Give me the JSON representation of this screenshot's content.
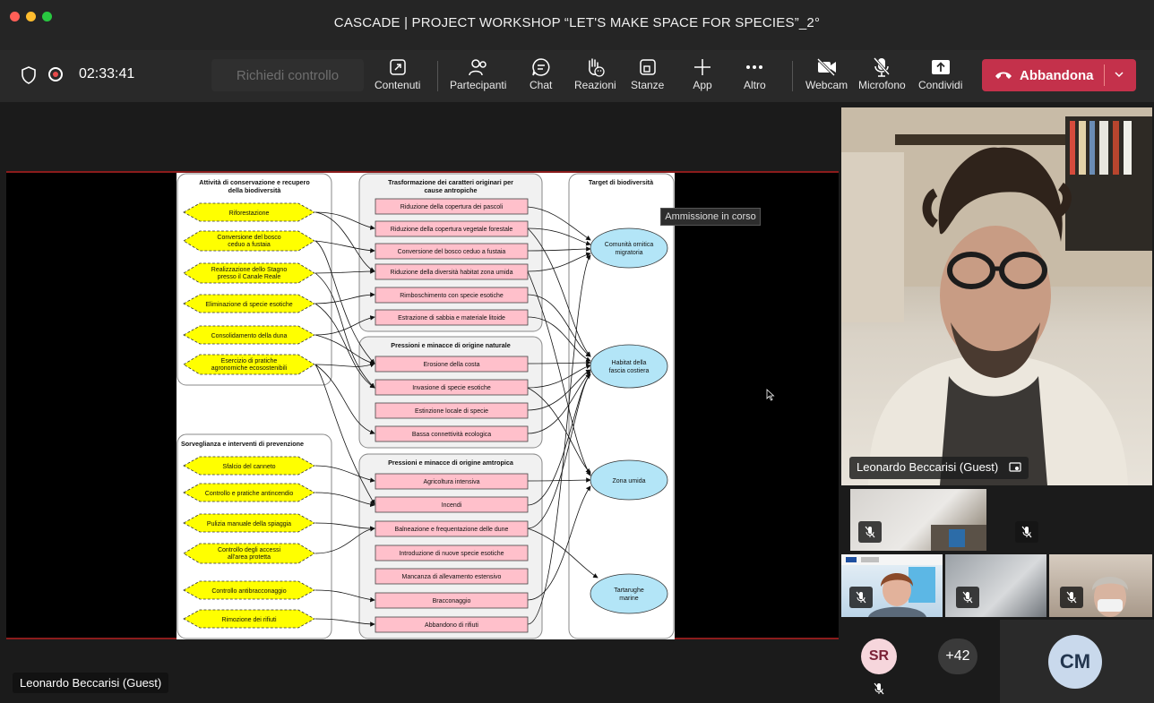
{
  "window": {
    "title": "CASCADE | PROJECT WORKSHOP “LET'S MAKE SPACE FOR SPECIES”_2°",
    "traffic_colors": [
      "#ff5f57",
      "#febc2e",
      "#28c840"
    ]
  },
  "toolbar": {
    "timer": "02:33:41",
    "request_control": "Richiedi controllo",
    "buttons": [
      {
        "id": "contenuti",
        "label": "Contenuti",
        "icon": "share-content-icon"
      },
      {
        "id": "partecipanti",
        "label": "Partecipanti",
        "icon": "people-icon"
      },
      {
        "id": "chat",
        "label": "Chat",
        "icon": "chat-icon"
      },
      {
        "id": "reazioni",
        "label": "Reazioni",
        "icon": "raise-hand-icon"
      },
      {
        "id": "stanze",
        "label": "Stanze",
        "icon": "rooms-icon"
      },
      {
        "id": "app",
        "label": "App",
        "icon": "plus-icon"
      },
      {
        "id": "altro",
        "label": "Altro",
        "icon": "more-icon"
      },
      {
        "id": "webcam",
        "label": "Webcam",
        "icon": "camera-off-icon"
      },
      {
        "id": "microfono",
        "label": "Microfono",
        "icon": "mic-off-icon"
      },
      {
        "id": "condividi",
        "label": "Condividi",
        "icon": "share-screen-icon"
      }
    ],
    "leave_label": "Abbandona",
    "leave_color": "#c4314b"
  },
  "stage": {
    "tooltip": "Ammissione in corso",
    "presenter_label": "Leonardo Beccarisi (Guest)"
  },
  "slide": {
    "col1_header": "Attività di conservazione e recupero della biodiversità",
    "col1_items": [
      "Riforestazione",
      "Conversione del bosco ceduo a fustaia",
      "Realizzazione dello Stagno presso il Canale Reale",
      "Eliminazione di specie esotiche",
      "Consolidamento della duna",
      "Esercizio di pratiche agronomiche ecosostenibili"
    ],
    "col1b_header": "Sorveglianza e interventi di prevenzione",
    "col1b_items": [
      "Sfalcio del canneto",
      "Controllo e pratiche antincendio",
      "Pulizia manuale della spiaggia",
      "Controllo degli accessi all'area protetta",
      "Controllo antibracconaggio",
      "Rimozione dei rifiuti"
    ],
    "col2_header": "Trasformazione dei caratteri originari per cause antropiche",
    "col2_items": [
      "Riduzione della copertura dei pascoli",
      "Riduzione della copertura vegetale forestale",
      "Conversione del bosco ceduo a fustaia",
      "Riduzione della diversità habitat zona umida",
      "Rimboschimento con specie esotiche",
      "Estrazione di sabbia e materiale litoide"
    ],
    "col2b_header": "Pressioni e minacce di origine naturale",
    "col2b_items": [
      "Erosione della costa",
      "Invasione di specie esotiche",
      "Estinzione locale di specie",
      "Bassa connettività ecologica"
    ],
    "col2c_header": "Pressioni e minacce di origine amtropica",
    "col2c_items": [
      "Agricoltura intensiva",
      "Incendi",
      "Balneazione e frequentazione delle dune",
      "Introduzione di nuove specie esotiche",
      "Mancanza di allevamento estensivo",
      "Bracconaggio",
      "Abbandono di rifiuti"
    ],
    "col3_header": "Target di biodiversità",
    "col3_items": [
      "Comunità ornitica migratoria",
      "Habitat della fascia costiera",
      "Zona umida",
      "Tartarughe marine"
    ],
    "colors": {
      "hexagon": "#ffff00",
      "box": "#ffc0cb",
      "ellipse": "#b3e5f7"
    }
  },
  "participants": {
    "main_name": "Leonardo Beccarisi (Guest)",
    "avatars": [
      {
        "initials": "SR",
        "bg": "#f6d6dc",
        "fg": "#7a2236"
      },
      {
        "initials": "+42",
        "bg": "#3a3a3a",
        "fg": "#ffffff"
      },
      {
        "initials": "CM",
        "bg": "#c9d9ec",
        "fg": "#23364f"
      }
    ]
  }
}
